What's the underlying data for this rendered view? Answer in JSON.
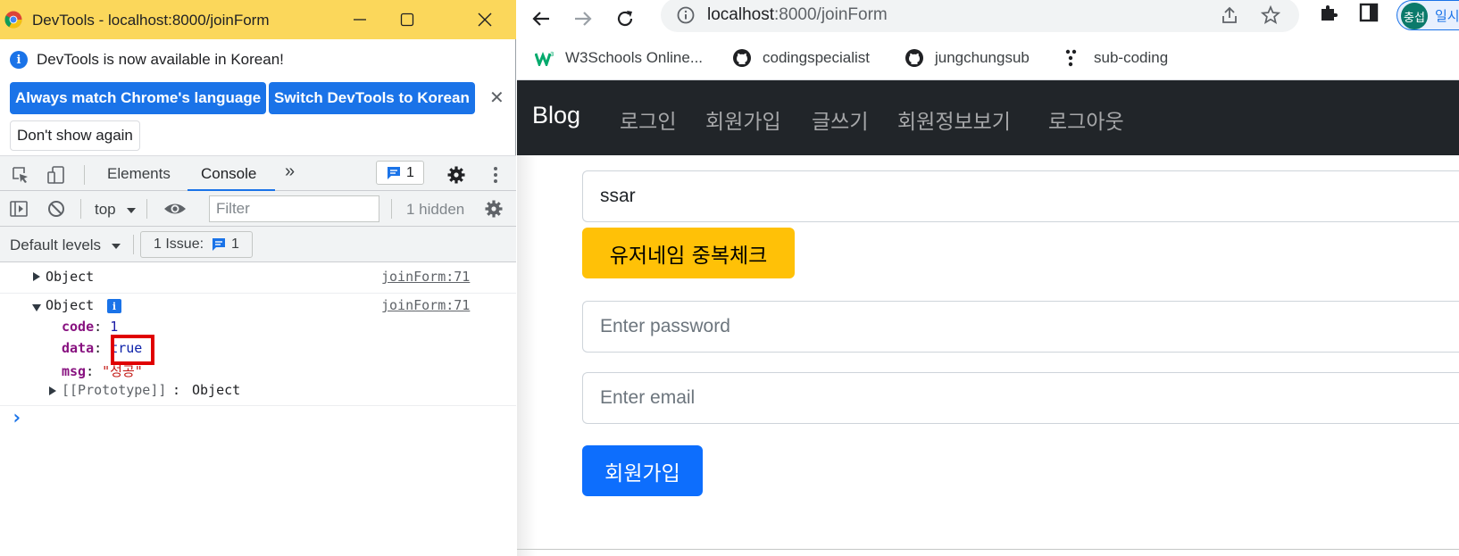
{
  "devtools": {
    "window_title": "DevTools - localhost:8000/joinForm",
    "infobar": {
      "message": "DevTools is now available in Korean!",
      "btn_match": "Always match Chrome's language",
      "btn_switch": "Switch DevTools to Korean",
      "btn_dont_show": "Don't show again",
      "close": "✕"
    },
    "tabs": {
      "elements": "Elements",
      "console": "Console",
      "more": "»",
      "issues_count": "1"
    },
    "filterbar": {
      "context": "top",
      "filter_placeholder": "Filter",
      "hidden": "1 hidden"
    },
    "levels": {
      "default_levels": "Default levels",
      "issue_label": "1 Issue:",
      "issue_count": "1"
    },
    "console": {
      "entries": [
        {
          "label": "Object",
          "source": "joinForm:71"
        },
        {
          "label": "Object",
          "source": "joinForm:71"
        }
      ],
      "expanded": {
        "code_key": "code",
        "code_val": "1",
        "data_key": "data",
        "data_val": "true",
        "msg_key": "msg",
        "msg_val": "\"성공\"",
        "proto_key": "[[Prototype]]",
        "proto_val": "Object"
      },
      "prompt": "›"
    }
  },
  "browser": {
    "url_host": "localhost",
    "url_path": ":8000/joinForm",
    "profile_avatar": "충섭",
    "profile_label": "일시",
    "bookmarks": [
      {
        "label": "W3Schools Online...",
        "icon": "w3schools-icon"
      },
      {
        "label": "codingspecialist",
        "icon": "github-icon"
      },
      {
        "label": "jungchungsub",
        "icon": "github-icon"
      },
      {
        "label": "sub-coding",
        "icon": "dots-icon"
      }
    ],
    "navbar": {
      "brand": "Blog",
      "links": [
        "로그인",
        "회원가입",
        "글쓰기",
        "회원정보보기",
        "로그아웃"
      ]
    },
    "form": {
      "username_value": "ssar",
      "check_button": "유저네임 중복체크",
      "password_placeholder": "Enter password",
      "email_placeholder": "Enter email",
      "submit_button": "회원가입"
    }
  },
  "colors": {
    "devtools_titlebar": "#fbd75b",
    "chrome_blue": "#1a73e8",
    "navbar_bg": "#212529",
    "warning_btn": "#ffc107",
    "primary_btn": "#0d6efd",
    "highlight_box": "#e00000"
  }
}
